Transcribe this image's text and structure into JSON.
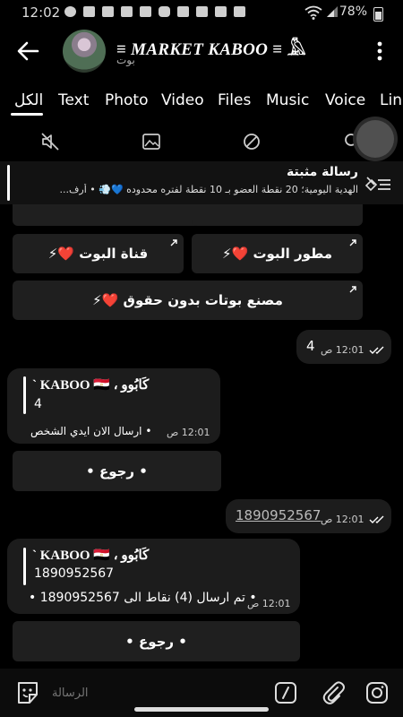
{
  "status": {
    "time": "12:02",
    "battery": "78%"
  },
  "header": {
    "title": "≡ MARKET KABOO ≡ 𓅓",
    "subtitle": "بوت"
  },
  "tabs": [
    "الكل",
    "Text",
    "Photo",
    "Video",
    "Files",
    "Music",
    "Voice",
    "Links"
  ],
  "toolbar": {
    "icons": [
      "mute-icon",
      "gallery-icon",
      "block-icon",
      "search-icon"
    ]
  },
  "pinned": {
    "title": "رسالة مثبتة",
    "text": "الهدية اليومية؛ 20 نقطة العضو بـ 10 نقطة لفتره محدوده 💙💨 • أرف..."
  },
  "keyboard_top": {
    "buttons": [
      {
        "label": "قناة البوت ❤️⚡"
      },
      {
        "label": "مطور البوت ❤️⚡"
      },
      {
        "label": "مصنع بوتات بدون حقوق ❤️⚡"
      }
    ]
  },
  "messages": [
    {
      "type": "out",
      "text": "4",
      "time": "12:01 ص"
    },
    {
      "type": "in",
      "quote_name": "` KABOO 🇪🇬 ، كَابُوو",
      "quote_text": "4",
      "text": "• ارسال الان ايدي الشخص",
      "time": "12:01 ص",
      "button": "• رجوع •"
    },
    {
      "type": "out",
      "text": "1890952567",
      "time": "12:01 ص"
    },
    {
      "type": "in",
      "quote_name": "` KABOO 🇪🇬 ، كَابُوو",
      "quote_text": "1890952567",
      "text": "• تم ارسال (4) نقاط الى 1890952567 •",
      "time": "12:01 ص",
      "button": "• رجوع •"
    }
  ],
  "input": {
    "placeholder": "الرسالة"
  },
  "colors": {
    "background": "#000000",
    "bubble": "#1c1c1c",
    "button": "#1f1f1f",
    "text": "#ffffff"
  }
}
